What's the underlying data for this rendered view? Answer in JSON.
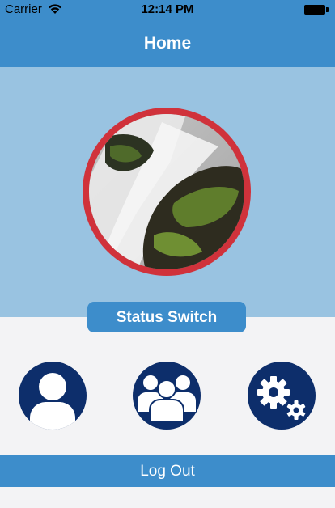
{
  "status_bar": {
    "carrier": "Carrier",
    "time": "12:14 PM"
  },
  "nav": {
    "title": "Home"
  },
  "actions": {
    "status_switch_label": "Status Switch"
  },
  "footer": {
    "logout_label": "Log Out"
  },
  "colors": {
    "accent": "#3d8dcb",
    "hero": "#99c3e1",
    "ring": "#d0323b",
    "circle_buttons": "#0d2e6b"
  }
}
